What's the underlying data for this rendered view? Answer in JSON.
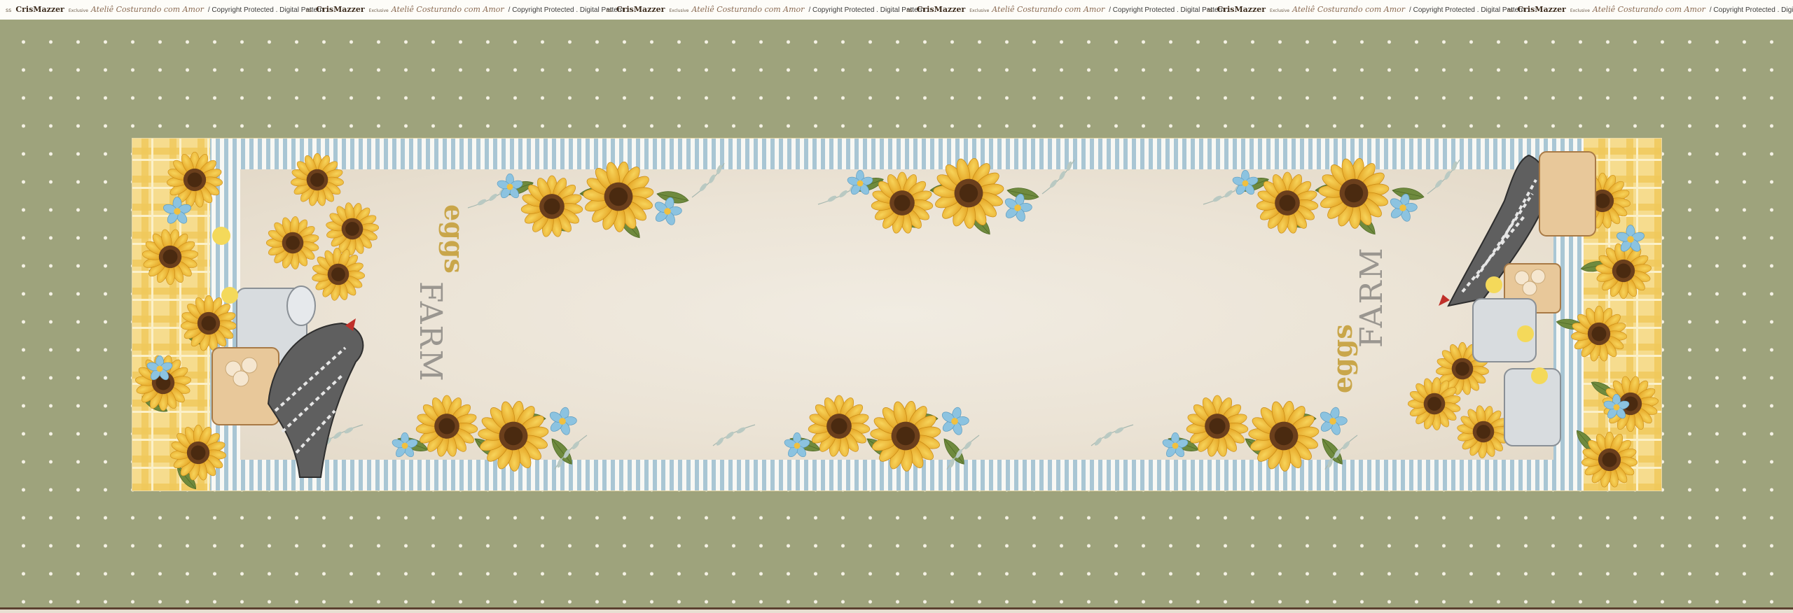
{
  "header": {
    "repeat_count": 6,
    "unit": {
      "dots": "ss",
      "brand": "CrisMazzer",
      "exclusive": "Exclusive",
      "script_name": "Ateliê Costurando com Amor",
      "copyright": "/ Copyright Protected . Digital Pattern ."
    }
  },
  "runner": {
    "left_label_small": "eggs",
    "left_label_big": "FARM",
    "right_label_small": "eggs",
    "right_label_big": "FARM"
  },
  "colors": {
    "background_green": "#9ea37c",
    "dot_white": "#f4f1e4",
    "stripe_blue": "#a9c6d4",
    "plaid_yellow": "#f0c85a",
    "cream_center": "#efe9dd",
    "sunflower_yellow": "#f0b92a",
    "sunflower_center": "#6b3f1c",
    "leaf_green": "#6f8a3e",
    "blue_flower": "#8cc3e0",
    "label_gold": "#c9a64a",
    "label_gray": "#9a9690"
  },
  "icons": {
    "sunflower": "sunflower-icon",
    "blue_flower": "blue-flower-icon",
    "hen": "hen-icon",
    "milk_can": "milk-can-icon",
    "egg_basket": "egg-basket-icon",
    "chick": "chick-icon"
  }
}
